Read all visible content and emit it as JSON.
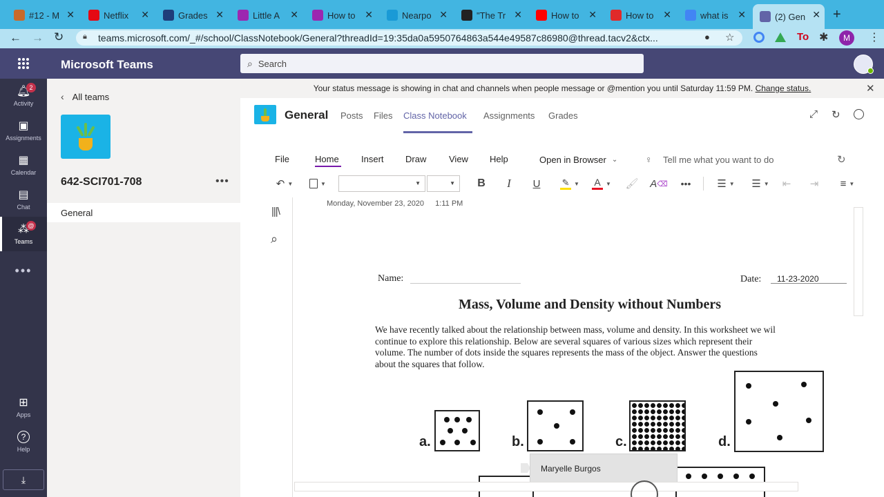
{
  "browser": {
    "tabs": [
      {
        "label": "#12 - M",
        "icon": "hand-icon",
        "color": "#c96a2b"
      },
      {
        "label": "Netflix",
        "icon": "netflix-icon",
        "color": "#e50914"
      },
      {
        "label": "Grades",
        "icon": "sis-icon",
        "color": "#1f3d7a"
      },
      {
        "label": "Little A",
        "icon": "flask-icon",
        "color": "#9c27b0"
      },
      {
        "label": "How to",
        "icon": "flask-icon",
        "color": "#9c27b0"
      },
      {
        "label": "Nearpo",
        "icon": "nearpod-icon",
        "color": "#1a9ad6"
      },
      {
        "label": "\"The Tr",
        "icon": "blackboard-icon",
        "color": "#222222"
      },
      {
        "label": "How to",
        "icon": "youtube-icon",
        "color": "#ff0000"
      },
      {
        "label": "How to",
        "icon": "t-icon",
        "color": "#e02a2a"
      },
      {
        "label": "what is",
        "icon": "google-icon",
        "color": "#4285f4"
      },
      {
        "label": "(2) Gen",
        "icon": "teams-icon",
        "color": "#6264a7"
      }
    ],
    "url": "teams.microsoft.com/_#/school/ClassNotebook/General?threadId=19:35da0a5950764863a544e49587c86980@thread.tacv2&ctx...",
    "profile_initial": "M"
  },
  "teams": {
    "app_name": "Microsoft Teams",
    "search_placeholder": "Search"
  },
  "rail": [
    {
      "label": "Activity",
      "icon": "bell-icon",
      "badge": "2"
    },
    {
      "label": "Assignments",
      "icon": "backpack-icon"
    },
    {
      "label": "Calendar",
      "icon": "calendar-icon"
    },
    {
      "label": "Chat",
      "icon": "chat-icon"
    },
    {
      "label": "Teams",
      "icon": "teams-icon",
      "badge": "@"
    },
    {
      "label": "Apps",
      "icon": "apps-icon"
    },
    {
      "label": "Help",
      "icon": "help-icon"
    }
  ],
  "left_panel": {
    "back_label": "All teams",
    "team_name": "642-SCI701-708",
    "channel": "General"
  },
  "banner": {
    "text": "Your status message is showing in chat and channels when people message or @mention you until Saturday 11:59 PM.",
    "link": "Change status."
  },
  "channel_header": {
    "name": "General",
    "tabs": [
      "Posts",
      "Files",
      "Class Notebook",
      "Assignments",
      "Grades"
    ],
    "active_tab": "Class Notebook"
  },
  "ribbon": {
    "menus": [
      "File",
      "Home",
      "Insert",
      "Draw",
      "View",
      "Help"
    ],
    "active_menu": "Home",
    "open_in_browser": "Open in Browser",
    "tell_me": "Tell me what you want to do"
  },
  "page": {
    "timestamp_date": "Monday, November 23, 2020",
    "timestamp_time": "1:11 PM",
    "name_label": "Name:",
    "date_label": "Date:",
    "date_value": "11-23-2020",
    "title": "Mass, Volume and Density without Numbers",
    "intro_lines": [
      "We have recently talked about the relationship between mass, volume and density.  In this worksheet we wil",
      "continue to explore this relationship.  Below are several squares of various sizes which represent their",
      "volume.  The number of dots inside the squares represents the mass of the object.  Answer the questions",
      "about the squares that follow."
    ],
    "square_labels": [
      "a.",
      "b.",
      "c.",
      "d."
    ],
    "collaborator": "Maryelle Burgos"
  }
}
